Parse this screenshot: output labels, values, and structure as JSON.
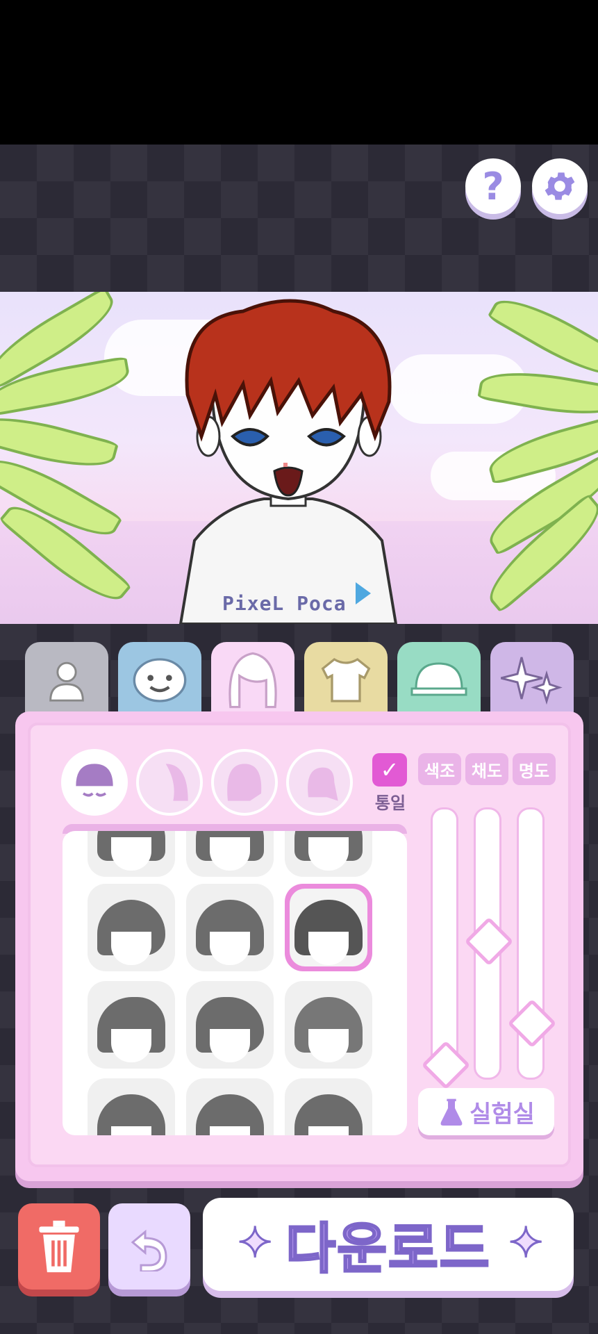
{
  "header": {
    "help_icon": "question-mark",
    "settings_icon": "gear"
  },
  "scene": {
    "shirt_logo": "PixeL Poca"
  },
  "tabs": [
    {
      "name": "body",
      "icon": "body-silhouette-icon",
      "color": "#b9b9c2"
    },
    {
      "name": "face",
      "icon": "smiley-face-icon",
      "color": "#9cc6e2"
    },
    {
      "name": "hair",
      "icon": "hair-icon",
      "color": "#f9d9f6",
      "active": true
    },
    {
      "name": "clothes",
      "icon": "t-shirt-icon",
      "color": "#e8dba2"
    },
    {
      "name": "hat",
      "icon": "cap-icon",
      "color": "#98dcc4"
    },
    {
      "name": "effects",
      "icon": "sparkle-icon",
      "color": "#cfb7e7"
    }
  ],
  "hair_panel": {
    "categories": [
      "front-hair",
      "back-hair",
      "side-hair",
      "ponytail"
    ],
    "sync_label": "통일",
    "adjust_buttons": [
      "색조",
      "채도",
      "명도"
    ],
    "sliders": {
      "hue": 0.9,
      "saturation": 0.5,
      "brightness": 0.8
    },
    "lab_label": "실험실",
    "selected_item": 6
  },
  "footer": {
    "download_label": "다운로드"
  },
  "colors": {
    "accent_pink": "#e25ad4",
    "panel_pink": "#f7c7ef",
    "trash_red": "#f06b66",
    "download_text": "#b99cf0"
  }
}
